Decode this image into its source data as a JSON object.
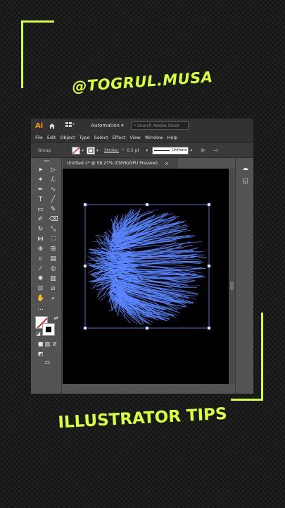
{
  "overlay": {
    "handle": "@TOGRUL.MUSA",
    "caption": "ILLUSTRATOR TIPS",
    "accent_color": "#d7ff3c"
  },
  "app": {
    "logo": "Ai",
    "workspace": "Automation",
    "search_placeholder": "Search Adobe Stock",
    "menu": [
      "File",
      "Edit",
      "Object",
      "Type",
      "Select",
      "Effect",
      "View",
      "Window",
      "Help"
    ],
    "control": {
      "selection_label": "Group",
      "stroke_label": "Stroke:",
      "stroke_value": "0.5 pt",
      "profile": "Uniform"
    },
    "document_tab": "Untitled-1* @ 58.27% (CMYK/GPU Preview)",
    "tab_close": "×",
    "artwork_color": "#5b86ff",
    "icons": [
      "home-icon",
      "workspace-icon",
      "stroke-swatch-icon",
      "fill-swatch-icon",
      "align-icon",
      "transform-icon",
      "selection-tool-icon",
      "direct-selection-tool-icon",
      "pen-tool-icon",
      "type-tool-icon",
      "hand-tool-icon",
      "zoom-tool-icon"
    ]
  }
}
